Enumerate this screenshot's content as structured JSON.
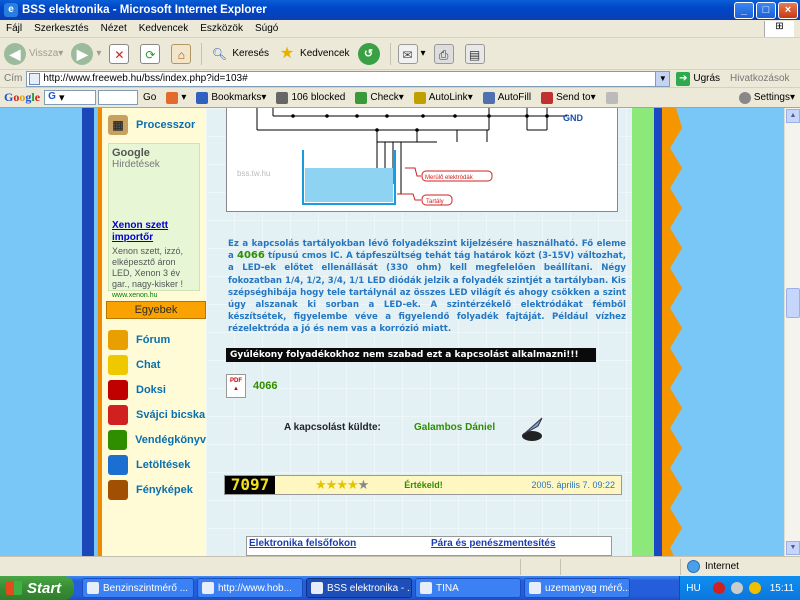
{
  "window": {
    "title": "BSS elektronika - Microsoft Internet Explorer"
  },
  "menu": [
    "Fájl",
    "Szerkesztés",
    "Nézet",
    "Kedvencek",
    "Eszközök",
    "Súgó"
  ],
  "toolbar": {
    "back": "Vissza",
    "search": "Keresés",
    "favorites": "Kedvencek"
  },
  "address": {
    "label": "Cím",
    "url": "http://www.freeweb.hu/bss/index.php?id=103#",
    "go": "Ugrás",
    "links": "Hivatkozások"
  },
  "google_bar": {
    "logo_parts": [
      "G",
      "o",
      "o",
      "g",
      "l",
      "e"
    ],
    "go": "Go",
    "bookmarks": "Bookmarks",
    "blocked": "106 blocked",
    "check": "Check",
    "autolink": "AutoLink",
    "autofill": "AutoFill",
    "send_to": "Send to",
    "settings": "Settings"
  },
  "sidebar": {
    "processzor": "Processzor",
    "ads_header_brand": "Google",
    "ads_header": "Hirdetések",
    "ad_title": "Xenon szett importőr",
    "ad_text": "Xenon szett, izzó, elképesztő áron LED, Xenon 3 év gar., nagy-kisker !",
    "ad_url": "www.xenon.hu",
    "egyebek": "Egyebek",
    "items": [
      {
        "label": "Fórum",
        "icon": "forum-icon",
        "color": "#e8a000"
      },
      {
        "label": "Chat",
        "icon": "chat-icon",
        "color": "#f0c800"
      },
      {
        "label": "Doksi",
        "icon": "pdf-icon",
        "color": "#c00000"
      },
      {
        "label": "Svájci bicska",
        "icon": "knife-icon",
        "color": "#d02020"
      },
      {
        "label": "Vendégkönyv",
        "icon": "guestbook-icon",
        "color": "#2f8e00"
      },
      {
        "label": "Letöltések",
        "icon": "download-icon",
        "color": "#1a6fd0"
      },
      {
        "label": "Fényképek",
        "icon": "photo-icon",
        "color": "#a05000"
      }
    ]
  },
  "diagram": {
    "gnd": "GND",
    "watermark": "bss.tw.hu",
    "label_electrodes": "Merülő elektródák",
    "label_tank": "Tartály"
  },
  "content": {
    "para_1": "Ez a kapcsolás tartályokban lévő folyadékszint kijelzésére használható. Fő eleme a ",
    "chip": "4066",
    "para_2": " típusú cmos IC. A tápfeszültség tehát tág határok közt (3-15V) változhat, a LED-ek előtet ellenállását (330 ohm) kell megfelelően beállítani. Négy fokozatban 1/4, 1/2, 3/4, 1/1 LED diódák jelzik a folyadék szintjét a tartályban. Kis szépséghibája hogy tele tartálynál az összes LED világít és ahogy csökken a szint úgy alszanak ki sorban a LED-ek. A szintérzékelő elektródákat fémből készítsétek, figyelembe véve a figyelendő folyadék fajtáját. Például vízhez rézelektróda a jó és nem vas a korrózió miatt.",
    "warning": "Gyúlékony folyadékokhoz nem szabad ezt a kapcsolást alkalmazni!!!",
    "pdf_label": "4066",
    "sent_by_label": "A kapcsolást küldte:",
    "author": "Galambos Dániel"
  },
  "rating": {
    "counter": "7097",
    "stars_filled": 4,
    "stars_total": 5,
    "rate_link": "Értékeld!",
    "date": "2005. április 7.  09:22"
  },
  "bottom_links": [
    "Elektronika felsőfokon",
    "Pára és penészmentesítés"
  ],
  "status": {
    "zone": "Internet"
  },
  "taskbar": {
    "start": "Start",
    "tasks": [
      "Benzinszintmérő ...",
      "http://www.hob...",
      "BSS elektronika - ...",
      "TINA",
      "uzemanyag mérő..."
    ],
    "lang": "HU",
    "clock": "15:11"
  }
}
